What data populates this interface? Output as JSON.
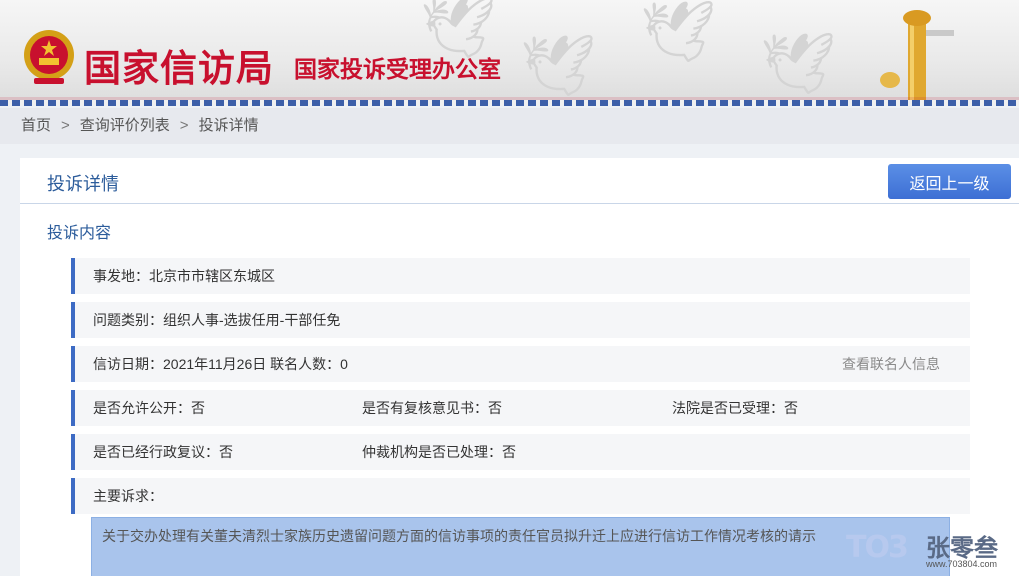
{
  "header": {
    "title_main": "国家信访局",
    "title_sub": "国家投诉受理办公室"
  },
  "breadcrumb": {
    "items": [
      "首页",
      "查询评价列表",
      "投诉详情"
    ],
    "separator": ">"
  },
  "card": {
    "title": "投诉详情",
    "back_label": "返回上一级",
    "section_title": "投诉内容"
  },
  "details": {
    "location": "事发地：北京市市辖区东城区",
    "category": "问题类别：组织人事-选拔任用-干部任免",
    "date_count": "信访日期：2021年11月26日 联名人数：0",
    "view_cosigners": "查看联名人信息",
    "allow_public": "是否允许公开：否",
    "has_review_opinion": "是否有复核意见书：否",
    "court_accepted": "法院是否已受理：否",
    "admin_reconsideration": "是否已经行政复议：否",
    "arbitration_handled": "仲裁机构是否已处理：否",
    "main_request_label": "主要诉求：",
    "main_request_text": "关于交办处理有关董夫清烈士家族历史遗留问题方面的信访事项的责任官员拟升迁上应进行信访工作情况考核的请示"
  },
  "watermark": {
    "logo": "TO3",
    "text": "张零叁",
    "url": "www.703804.com"
  },
  "colors": {
    "brand_red": "#c8102e",
    "accent_blue": "#2c5c9b",
    "button_blue": "#4a7fdc",
    "row_border": "#3d6bc4"
  }
}
